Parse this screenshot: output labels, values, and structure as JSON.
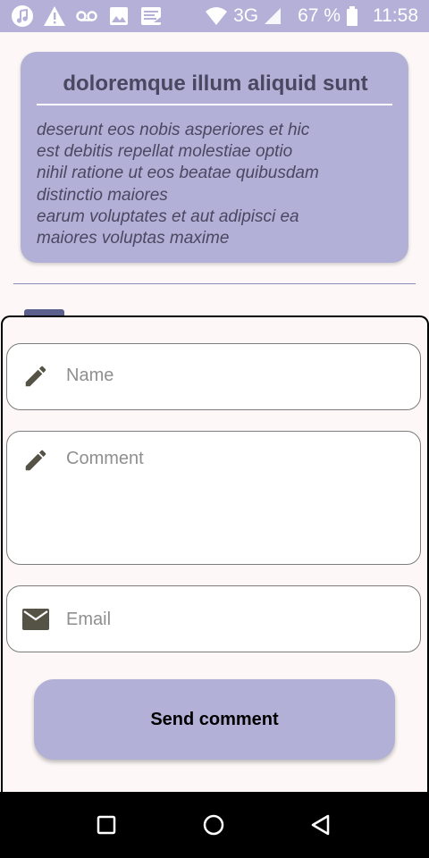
{
  "status_bar": {
    "network": "3G",
    "battery": "67 %",
    "time": "11:58",
    "left_icons": [
      "music-icon",
      "warning-icon",
      "voicemail-icon",
      "image-icon",
      "news-icon"
    ]
  },
  "article": {
    "title": "doloremque illum aliquid sunt",
    "body_lines": [
      "deserunt eos nobis asperiores et hic",
      "est debitis repellat molestiae optio",
      "nihil ratione ut eos beatae quibusdam",
      "distinctio maiores",
      "earum voluptates et aut adipisci ea",
      "maiores voluptas maxime"
    ]
  },
  "form": {
    "name": {
      "placeholder": "Name",
      "value": "",
      "icon": "pencil-icon"
    },
    "comment": {
      "placeholder": "Comment",
      "value": "",
      "icon": "pencil-icon"
    },
    "email": {
      "placeholder": "Email",
      "value": "",
      "icon": "mail-icon"
    },
    "send_label": "Send comment"
  },
  "nav_bar": {
    "buttons": [
      "recents-button",
      "home-button",
      "back-button"
    ]
  },
  "colors": {
    "accent": "#b3b0d8",
    "article_text": "#4a4760",
    "background": "#fdf8f7",
    "icon": "#555346"
  }
}
